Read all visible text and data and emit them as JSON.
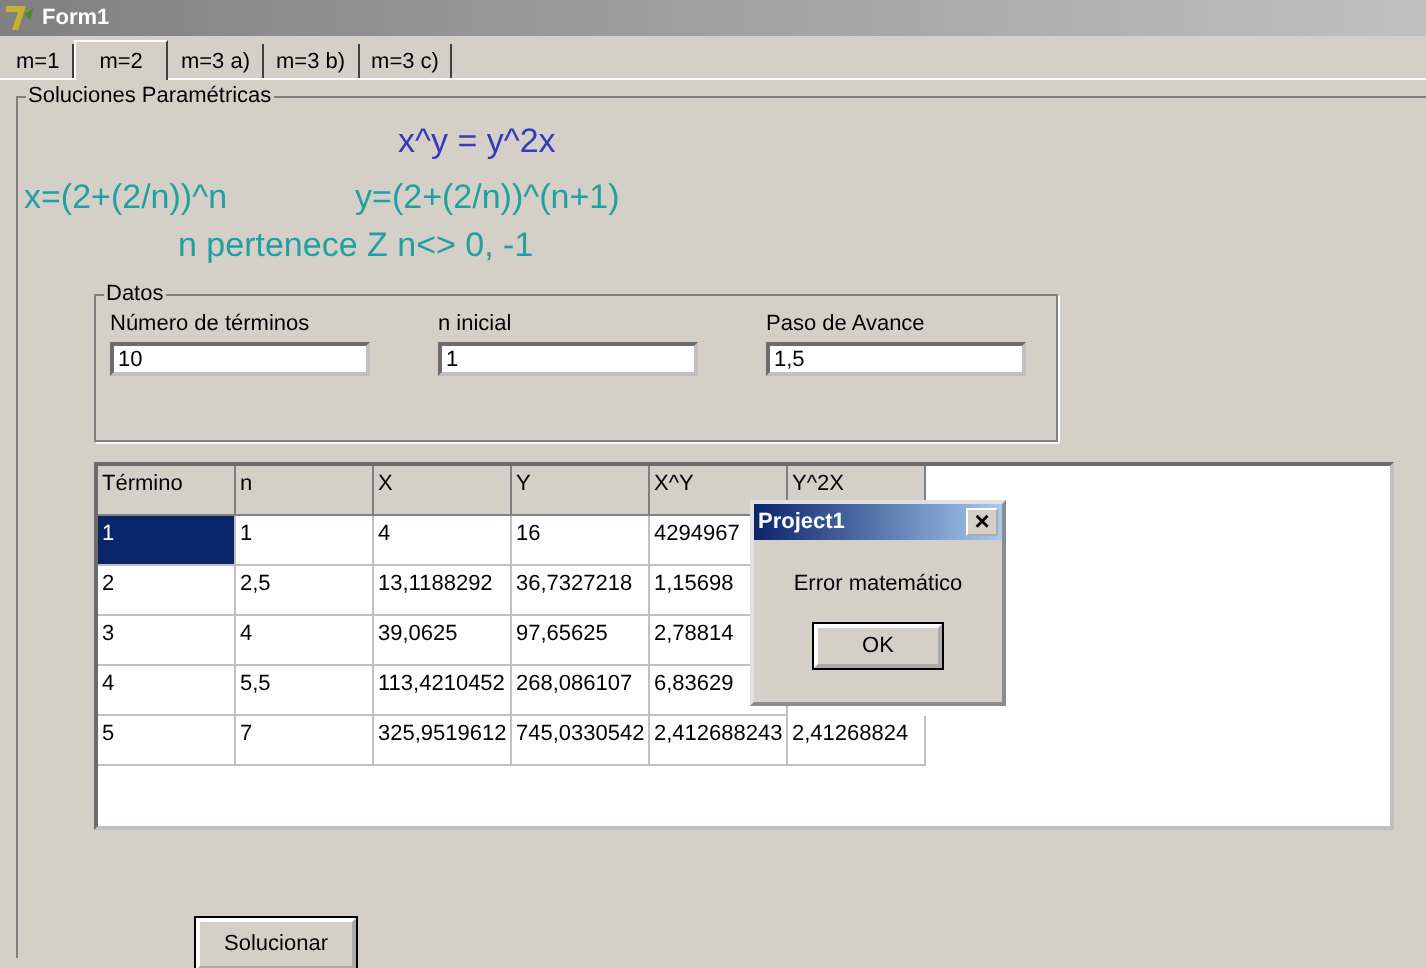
{
  "window": {
    "title": "Form1"
  },
  "tabs": [
    {
      "label": "m=1",
      "selected": false
    },
    {
      "label": "m=2",
      "selected": true
    },
    {
      "label": "m=3  a)",
      "selected": false
    },
    {
      "label": "m=3  b)",
      "selected": false
    },
    {
      "label": "m=3  c)",
      "selected": false
    }
  ],
  "group_title": "Soluciones Paramétricas",
  "formulas": {
    "equation": "x^y = y^2x",
    "x_formula": "x=(2+(2/n))^n",
    "y_formula": "y=(2+(2/n))^(n+1)",
    "condition": "n pertenece Z    n<> 0, -1"
  },
  "datos": {
    "title": "Datos",
    "fields": [
      {
        "label": "Número de términos",
        "value": "10"
      },
      {
        "label": "n inicial",
        "value": "1"
      },
      {
        "label": "Paso de Avance",
        "value": "1,5"
      }
    ]
  },
  "table": {
    "columns": [
      "Término",
      "n",
      "X",
      "Y",
      "X^Y",
      "Y^2X"
    ],
    "rows": [
      {
        "selected": true,
        "cells": [
          "1",
          "1",
          "4",
          "16",
          "4294967"
        ]
      },
      {
        "selected": false,
        "cells": [
          "2",
          "2,5",
          "13,1188292",
          "36,7327218",
          "1,15698"
        ]
      },
      {
        "selected": false,
        "cells": [
          "3",
          "4",
          "39,0625",
          "97,65625",
          "2,78814"
        ]
      },
      {
        "selected": false,
        "cells": [
          "4",
          "5,5",
          "113,4210452",
          "268,086107",
          "6,83629"
        ]
      },
      {
        "selected": false,
        "cells": [
          "5",
          "7",
          "325,9519612",
          "745,0330542",
          "2,412688243",
          "2,41268824"
        ]
      }
    ]
  },
  "solve_button": "Solucionar",
  "dialog": {
    "title": "Project1",
    "close": "×",
    "message": "Error matemático",
    "button": "OK"
  }
}
